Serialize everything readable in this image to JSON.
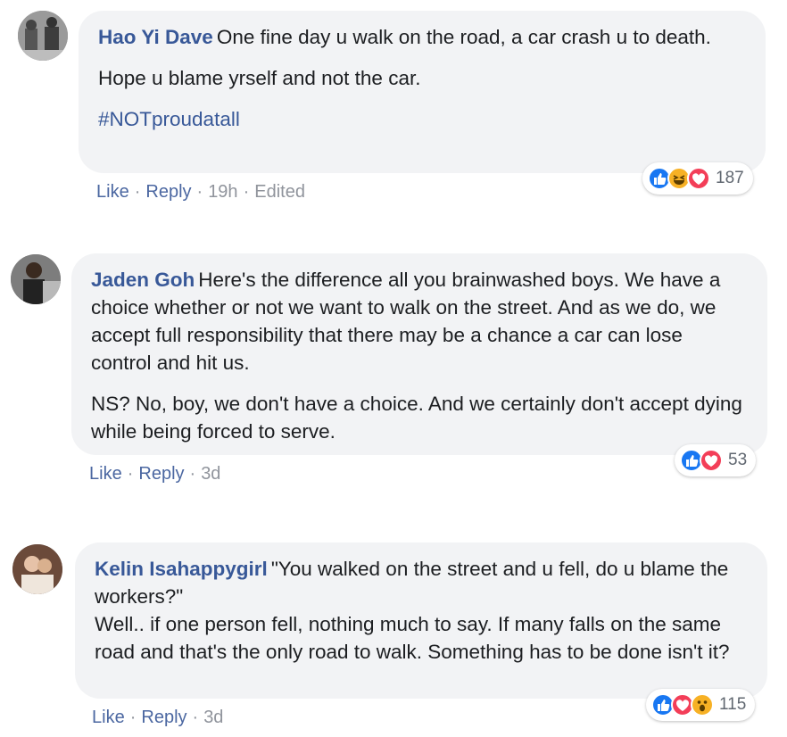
{
  "comments": [
    {
      "author": "Hao Yi Dave",
      "paragraphs": [
        "One fine day u walk on the road, a car crash u to death.",
        "Hope u blame yrself and not the car."
      ],
      "hashtag": "#NOTproudatall",
      "like_label": "Like",
      "reply_label": "Reply",
      "time": "19h",
      "edited": "Edited",
      "reactions": [
        "like-icon",
        "haha-icon",
        "love-icon"
      ],
      "reaction_count": "187"
    },
    {
      "author": "Jaden Goh",
      "paragraphs": [
        "Here's the difference all you brainwashed boys. We have a choice whether or not we want to walk on the street. And as we do, we accept full responsibility that there may be a chance a car can lose control and hit us.",
        "NS? No, boy, we don't have a choice. And we certainly don't accept dying while being forced to serve."
      ],
      "like_label": "Like",
      "reply_label": "Reply",
      "time": "3d",
      "reactions": [
        "like-icon",
        "love-icon"
      ],
      "reaction_count": "53"
    },
    {
      "author": "Kelin Isahappygirl",
      "paragraphs": [
        "\"You walked on the street and u fell, do u blame the workers?\"",
        "Well.. if one person fell, nothing much to say. If many falls on the same road and that's the only road to walk. Something has to be done isn't it?"
      ],
      "like_label": "Like",
      "reply_label": "Reply",
      "time": "3d",
      "reactions": [
        "like-icon",
        "love-icon",
        "wow-icon"
      ],
      "reaction_count": "115"
    }
  ],
  "colors": {
    "author": "#385898",
    "bubble": "#f2f3f5",
    "meta": "#90949c",
    "like_blue": "#1877f2",
    "love_red": "#f33e58",
    "emoji_yellow": "#f7b125"
  }
}
